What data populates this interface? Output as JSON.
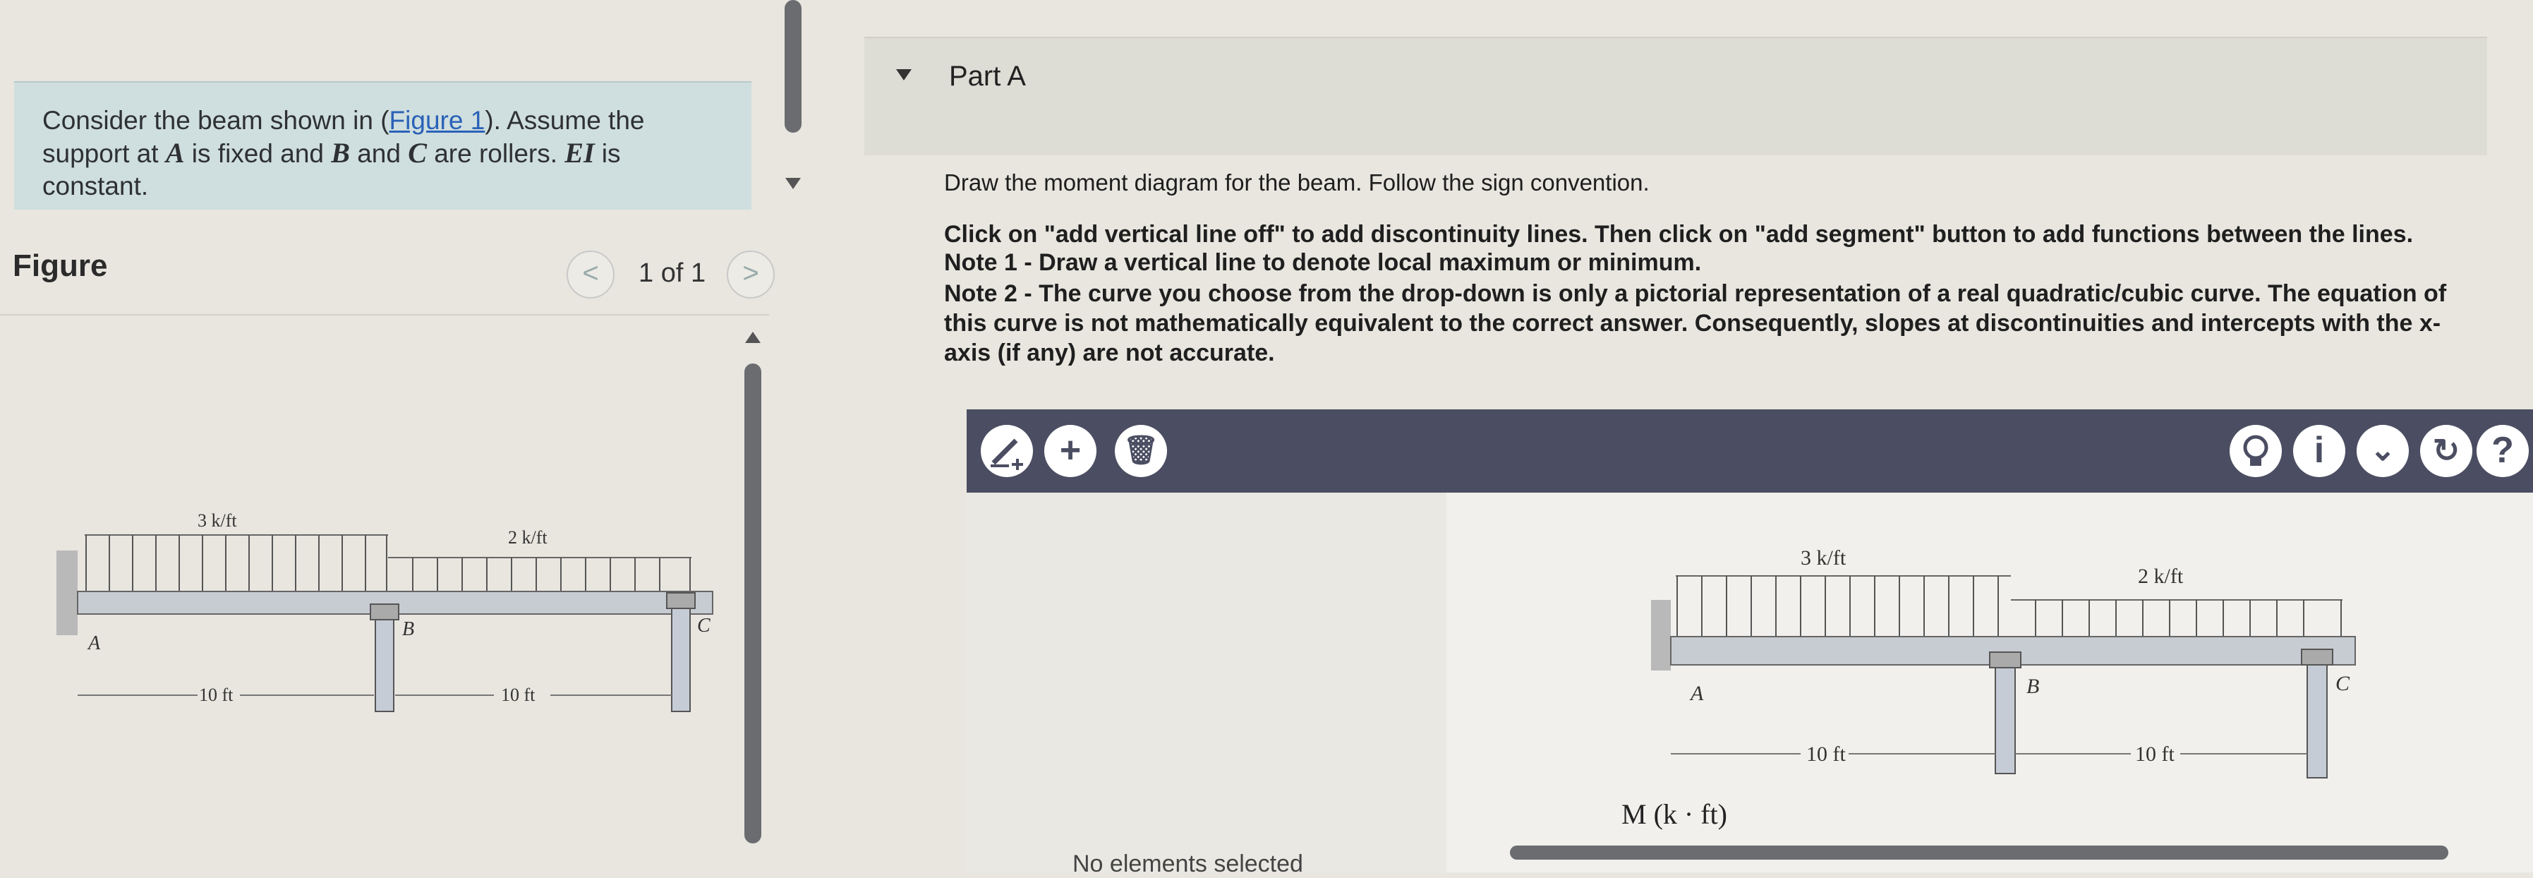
{
  "problem": {
    "intro": "Consider the beam shown in (",
    "figure_link": "Figure 1",
    "after_link": "). Assume the",
    "line2_a": "support at ",
    "var_A": "A",
    "line2_b": " is fixed and ",
    "var_B": "B",
    "line2_c": " and ",
    "var_C": "C",
    "line2_d": " are rollers. ",
    "var_EI": "EI",
    "line2_e": " is",
    "line3": "constant."
  },
  "figure_panel": {
    "title": "Figure",
    "pager": "1 of 1",
    "prev_glyph": "<",
    "next_glyph": ">"
  },
  "beam": {
    "load_left": "3 k/ft",
    "load_right": "2 k/ft",
    "support_A": "A",
    "support_B": "B",
    "support_C": "C",
    "span_left": "10 ft",
    "span_right": "10 ft"
  },
  "part": {
    "title": "Part A",
    "instruction": "Draw the moment diagram for the beam. Follow the sign convention.",
    "note0": "Click on \"add vertical line off\" to add discontinuity lines. Then click on \"add segment\" button to add functions between the lines.",
    "note1": "Note 1 - Draw a vertical line to denote local maximum or minimum.",
    "note2a": "Note 2 - The curve you choose from the drop-down is only a pictorial representation of a real quadratic/cubic curve. The equation of",
    "note2b": "this curve is not mathematically equivalent to the correct answer. Consequently, slopes at discontinuities and intercepts with the x-",
    "note2c": "axis (if any) are not accurate."
  },
  "toolbar": {
    "add_segment_glyph": "+",
    "delete_glyph": "🗑",
    "info_glyph": "i",
    "chevron_glyph": "⌄",
    "reset_glyph": "↻",
    "help_glyph": "?"
  },
  "canvas": {
    "status": "No elements selected",
    "axis_label": "M (k · ft)"
  },
  "colors": {
    "toolbar_bg": "#4b4e62",
    "problem_bg": "#cfdede",
    "link": "#2a62b8"
  }
}
